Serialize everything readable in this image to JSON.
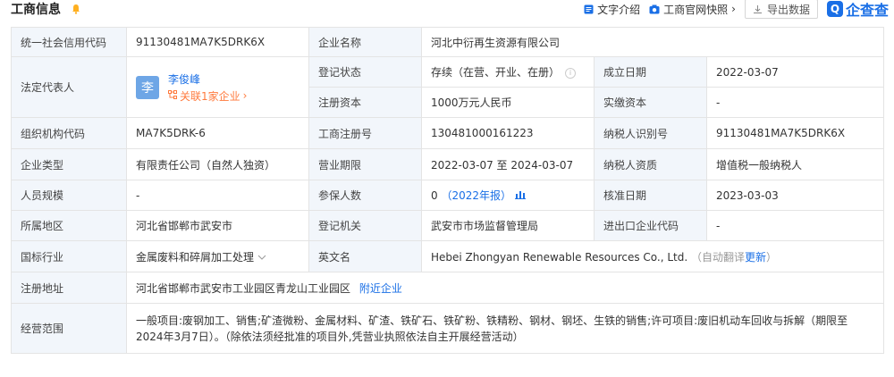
{
  "header": {
    "title": "工商信息",
    "links": {
      "text_intro": "文字介绍",
      "official_snapshot": "工商官网快照",
      "official_arrow": "›",
      "export": "导出数据"
    },
    "brand": "企查查"
  },
  "table": {
    "credit_code_label": "统一社会信用代码",
    "credit_code_value": "91130481MA7K5DRK6X",
    "company_name_label": "企业名称",
    "company_name_value": "河北中衍再生资源有限公司",
    "legal_rep_label": "法定代表人",
    "legal_rep_avatar": "李",
    "legal_rep_name": "李俊峰",
    "legal_rep_related": "关联1家企业",
    "legal_rep_related_arrow": "›",
    "reg_status_label": "登记状态",
    "reg_status_value": "存续（在营、开业、在册）",
    "found_date_label": "成立日期",
    "found_date_value": "2022-03-07",
    "reg_capital_label": "注册资本",
    "reg_capital_value": "1000万元人民币",
    "paid_capital_label": "实缴资本",
    "paid_capital_value": "-",
    "org_code_label": "组织机构代码",
    "org_code_value": "MA7K5DRK-6",
    "biz_reg_no_label": "工商注册号",
    "biz_reg_no_value": "130481000161223",
    "taxpayer_id_label": "纳税人识别号",
    "taxpayer_id_value": "91130481MA7K5DRK6X",
    "company_type_label": "企业类型",
    "company_type_value": "有限责任公司（自然人独资）",
    "biz_term_label": "营业期限",
    "biz_term_value": "2022-03-07 至 2024-03-07",
    "taxpayer_qual_label": "纳税人资质",
    "taxpayer_qual_value": "增值税一般纳税人",
    "staff_size_label": "人员规模",
    "staff_size_value": "-",
    "insured_label": "参保人数",
    "insured_value": "0",
    "insured_year": "（2022年报）",
    "approve_date_label": "核准日期",
    "approve_date_value": "2023-03-03",
    "region_label": "所属地区",
    "region_value": "河北省邯郸市武安市",
    "reg_authority_label": "登记机关",
    "reg_authority_value": "武安市市场监督管理局",
    "import_export_label": "进出口企业代码",
    "import_export_value": "-",
    "industry_label": "国标行业",
    "industry_value": "金属废料和碎屑加工处理",
    "english_name_label": "英文名",
    "english_name_value": "Hebei Zhongyan Renewable Resources Co., Ltd.",
    "auto_translate": "（自动翻译",
    "update": "更新",
    "auto_translate_close": "）",
    "address_label": "注册地址",
    "address_value": "河北省邯郸市武安市工业园区青龙山工业园区",
    "nearby": "附近企业",
    "scope_label": "经营范围",
    "scope_value": "一般项目:废钢加工、销售;矿渣微粉、金属材料、矿渣、铁矿石、铁矿粉、铁精粉、钢材、钢坯、生铁的销售;许可项目:废旧机动车回收与拆解（期限至2024年3月7日）。（除依法须经批准的项目外,凭营业执照依法自主开展经营活动）"
  },
  "colors": {
    "accent": "#1a6fe6",
    "orange": "#ff7a3d",
    "label_bg": "#f2f6fb"
  }
}
